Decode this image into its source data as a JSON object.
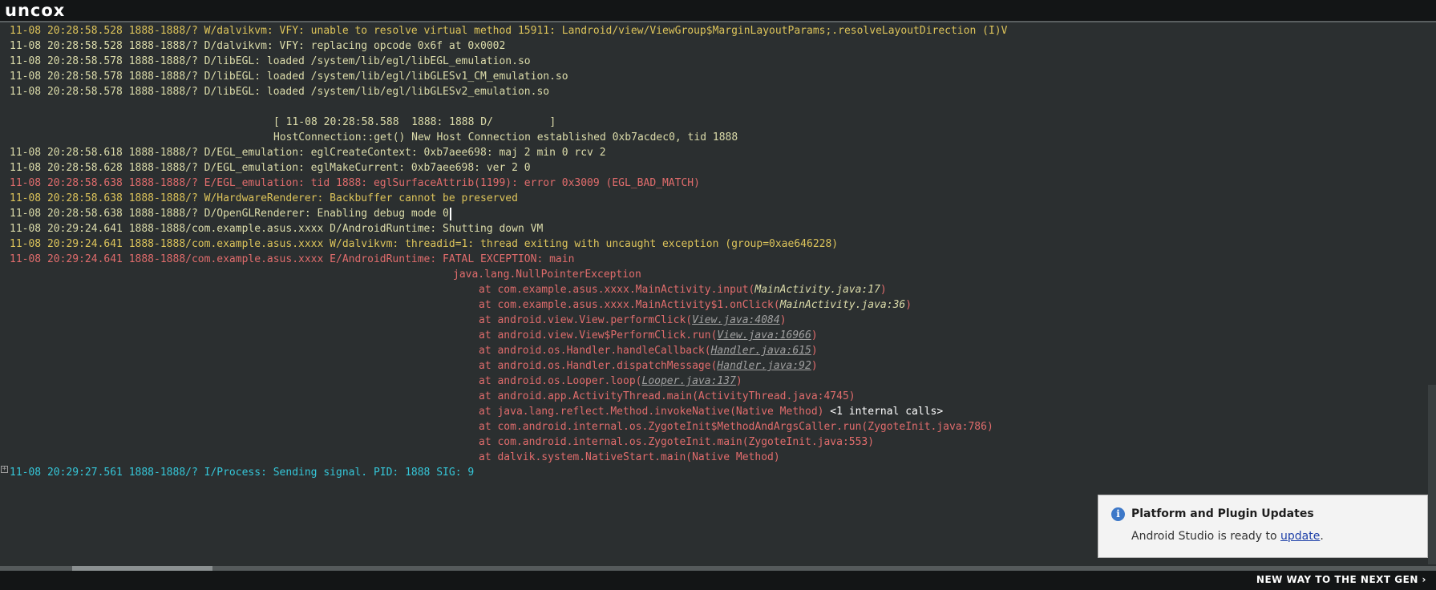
{
  "header": {
    "brand": "uncox"
  },
  "footer": {
    "tagline": "NEW WAY TO THE NEXT GEN ›"
  },
  "log": {
    "l1": "11-08 20:28:58.528 1888-1888/? W/dalvikvm: VFY: unable to resolve virtual method 15911: Landroid/view/ViewGroup$MarginLayoutParams;.resolveLayoutDirection (I)V",
    "l2": "11-08 20:28:58.528 1888-1888/? D/dalvikvm: VFY: replacing opcode 0x6f at 0x0002",
    "l3": "11-08 20:28:58.578 1888-1888/? D/libEGL: loaded /system/lib/egl/libEGL_emulation.so",
    "l4": "11-08 20:28:58.578 1888-1888/? D/libEGL: loaded /system/lib/egl/libGLESv1_CM_emulation.so",
    "l5": "11-08 20:28:58.578 1888-1888/? D/libEGL: loaded /system/lib/egl/libGLESv2_emulation.so",
    "l6": "[ 11-08 20:28:58.588  1888: 1888 D/         ]",
    "l7": "HostConnection::get() New Host Connection established 0xb7acdec0, tid 1888",
    "l8": "11-08 20:28:58.618 1888-1888/? D/EGL_emulation: eglCreateContext: 0xb7aee698: maj 2 min 0 rcv 2",
    "l9": "11-08 20:28:58.628 1888-1888/? D/EGL_emulation: eglMakeCurrent: 0xb7aee698: ver 2 0",
    "l10": "11-08 20:28:58.638 1888-1888/? E/EGL_emulation: tid 1888: eglSurfaceAttrib(1199): error 0x3009 (EGL_BAD_MATCH)",
    "l11": "11-08 20:28:58.638 1888-1888/? W/HardwareRenderer: Backbuffer cannot be preserved",
    "l12": "11-08 20:28:58.638 1888-1888/? D/OpenGLRenderer: Enabling debug mode 0",
    "l13": "11-08 20:29:24.641 1888-1888/com.example.asus.xxxx D/AndroidRuntime: Shutting down VM",
    "l14": "11-08 20:29:24.641 1888-1888/com.example.asus.xxxx W/dalvikvm: threadid=1: thread exiting with uncaught exception (group=0xae646228)",
    "l15": "11-08 20:29:24.641 1888-1888/com.example.asus.xxxx E/AndroidRuntime: FATAL EXCEPTION: main",
    "l16": "java.lang.NullPointerException",
    "l30": "11-08 20:29:27.561 1888-1888/? I/Process: Sending signal. PID: 1888 SIG: 9"
  },
  "stack": [
    {
      "pre": "at com.example.asus.xxxx.MainActivity.input(",
      "file": "MainActivity.java:17",
      "post": ")"
    },
    {
      "pre": "at com.example.asus.xxxx.MainActivity$1.onClick(",
      "file": "MainActivity.java:36",
      "post": ")"
    },
    {
      "pre": "at android.view.View.performClick(",
      "file": "View.java:4084",
      "post": ")"
    },
    {
      "pre": "at android.view.View$PerformClick.run(",
      "file": "View.java:16966",
      "post": ")"
    },
    {
      "pre": "at android.os.Handler.handleCallback(",
      "file": "Handler.java:615",
      "post": ")"
    },
    {
      "pre": "at android.os.Handler.dispatchMessage(",
      "file": "Handler.java:92",
      "post": ")"
    },
    {
      "pre": "at android.os.Looper.loop(",
      "file": "Looper.java:137",
      "post": ")"
    },
    {
      "text": "at android.app.ActivityThread.main(ActivityThread.java:4745)"
    },
    {
      "text": "at java.lang.reflect.Method.invokeNative(Native Method)",
      "extra": " <1 internal calls>"
    },
    {
      "text": "at com.android.internal.os.ZygoteInit$MethodAndArgsCaller.run(ZygoteInit.java:786)"
    },
    {
      "text": "at com.android.internal.os.ZygoteInit.main(ZygoteInit.java:553)"
    },
    {
      "text": "at dalvik.system.NativeStart.main(Native Method)"
    }
  ],
  "fold_icon": "+",
  "notification": {
    "icon": "info-icon",
    "icon_glyph": "i",
    "title": "Platform and Plugin Updates",
    "body_prefix": "Android Studio is ready to ",
    "link": "update",
    "body_suffix": "."
  }
}
